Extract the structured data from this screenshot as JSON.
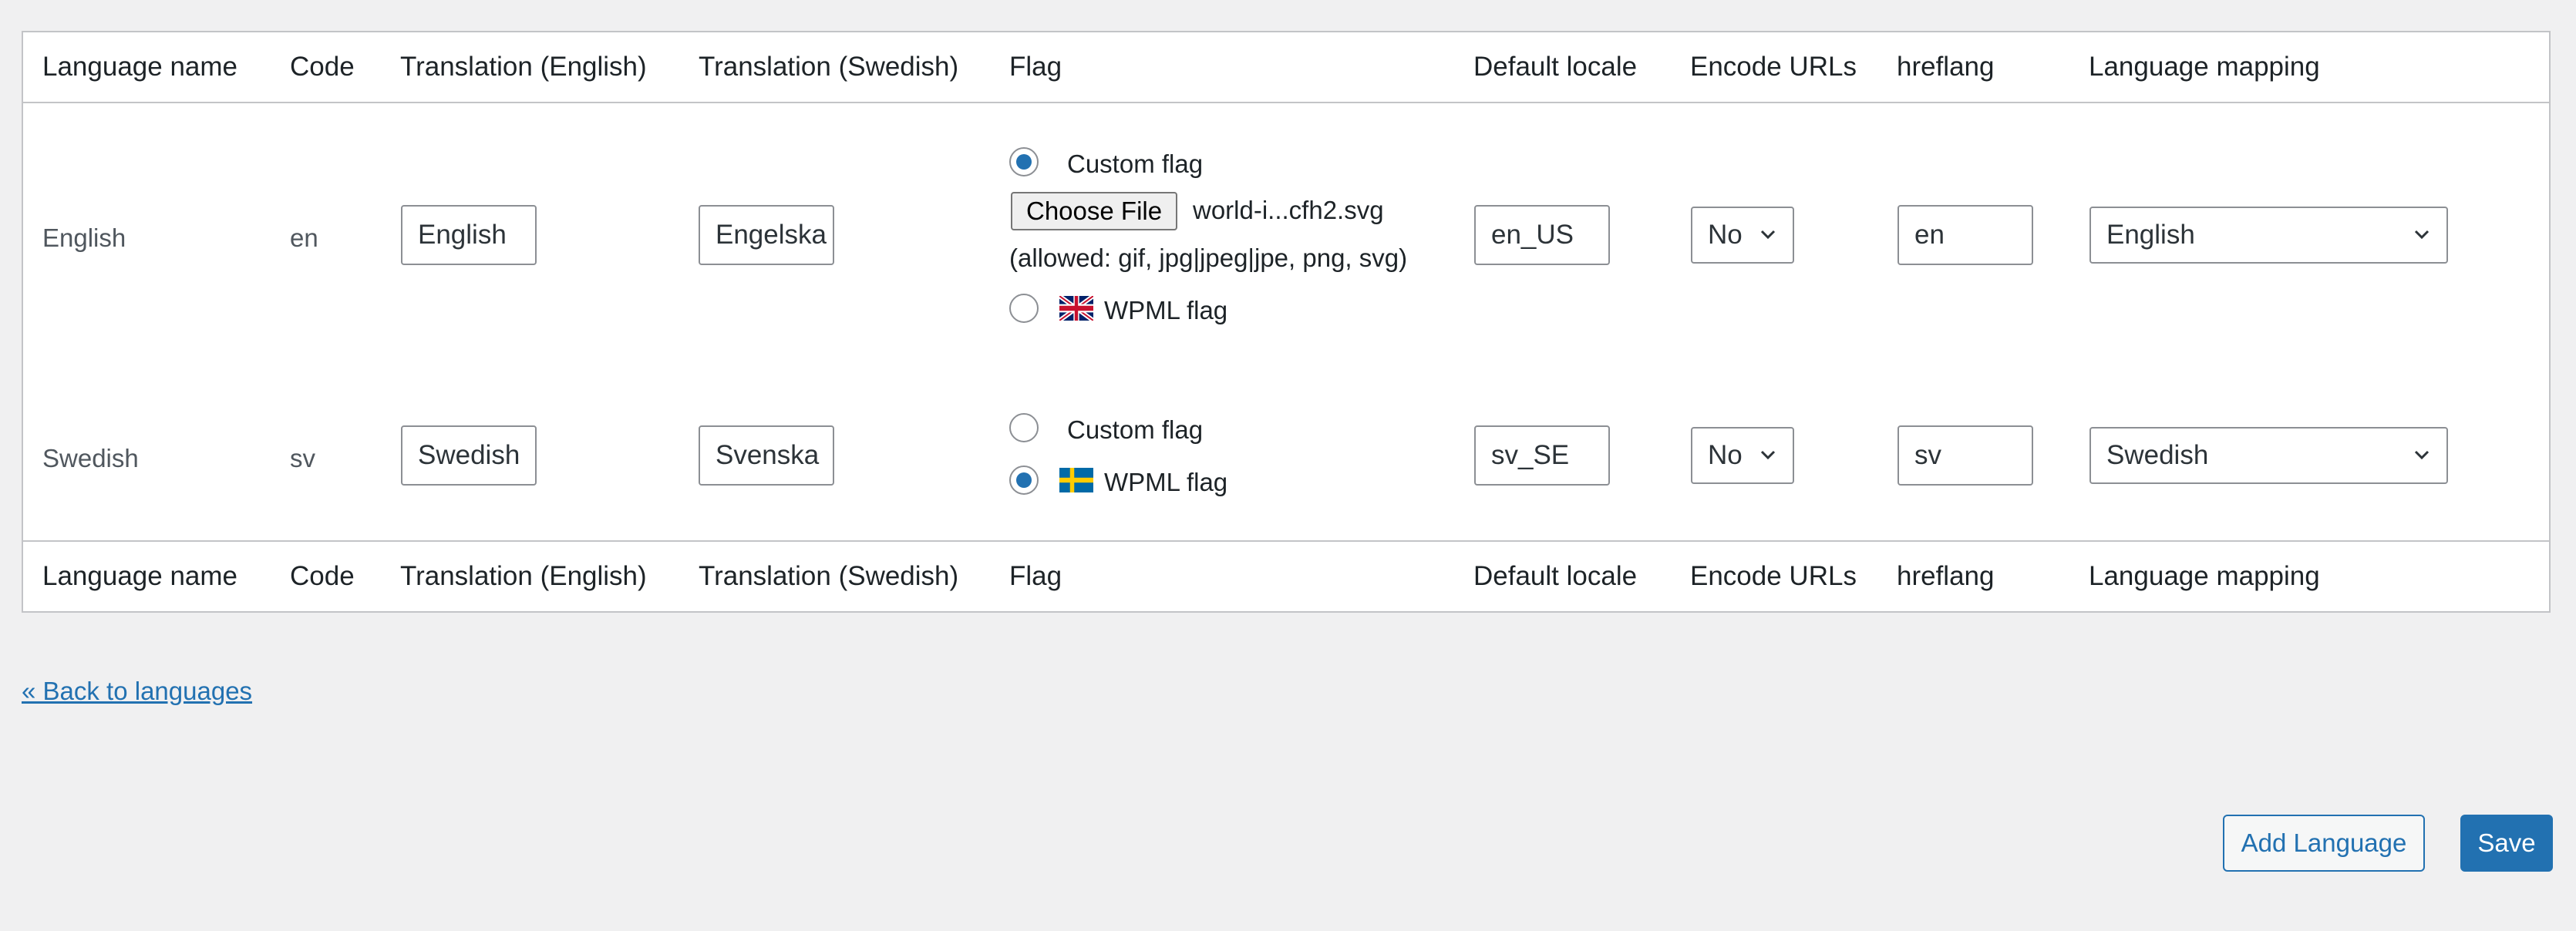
{
  "columns": {
    "language_name": "Language name",
    "code": "Code",
    "translation_english": "Translation (English)",
    "translation_swedish": "Translation (Swedish)",
    "flag": "Flag",
    "default_locale": "Default locale",
    "encode_urls": "Encode URLs",
    "hreflang": "hreflang",
    "language_mapping": "Language mapping"
  },
  "rows": [
    {
      "language_name": "English",
      "code": "en",
      "translation_english": "English",
      "translation_swedish": "Engelska",
      "flag": {
        "custom_flag_label": "Custom flag",
        "custom_selected": true,
        "choose_file_label": "Choose File",
        "file_name": "world-i...cfh2.svg",
        "allowed_text": "(allowed: gif, jpg|jpeg|jpe, png, svg)",
        "wpml_flag_label": "WPML flag",
        "wpml_icon": "uk-flag-icon"
      },
      "default_locale": "en_US",
      "encode_urls": "No",
      "hreflang": "en",
      "language_mapping": "English"
    },
    {
      "language_name": "Swedish",
      "code": "sv",
      "translation_english": "Swedish",
      "translation_swedish": "Svenska",
      "flag": {
        "custom_flag_label": "Custom flag",
        "custom_selected": false,
        "wpml_flag_label": "WPML flag",
        "wpml_icon": "sweden-flag-icon"
      },
      "default_locale": "sv_SE",
      "encode_urls": "No",
      "hreflang": "sv",
      "language_mapping": "Swedish"
    }
  ],
  "back_link": "« Back to languages",
  "buttons": {
    "add_language": "Add Language",
    "save": "Save"
  },
  "colors": {
    "accent": "#2271b1",
    "border": "#c3c4c7",
    "background": "#f0f0f1"
  }
}
